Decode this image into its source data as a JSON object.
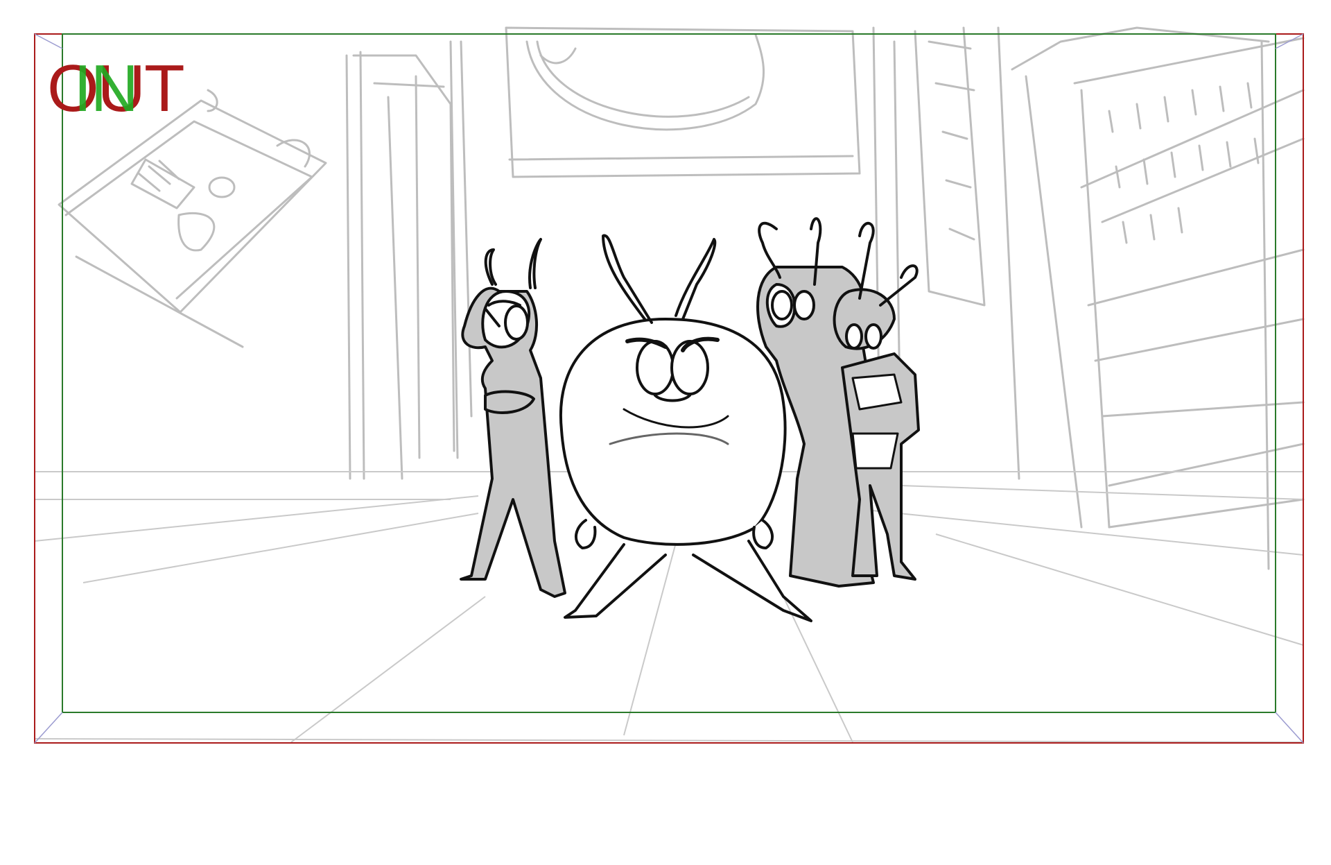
{
  "storyboard_panel": {
    "safe_frame_label_out": "OUT",
    "safe_frame_label_in": "IN",
    "colors": {
      "out_frame": "#aa1a1a",
      "in_frame": "#2a7a2a",
      "in_label": "#22aa22",
      "sketch_line": "#000000",
      "background_sketch": "#b9b9b9",
      "character_fill": "#c8c8c8",
      "perspective_guide": "#c8c8e8"
    },
    "scene_description_visible": false
  }
}
